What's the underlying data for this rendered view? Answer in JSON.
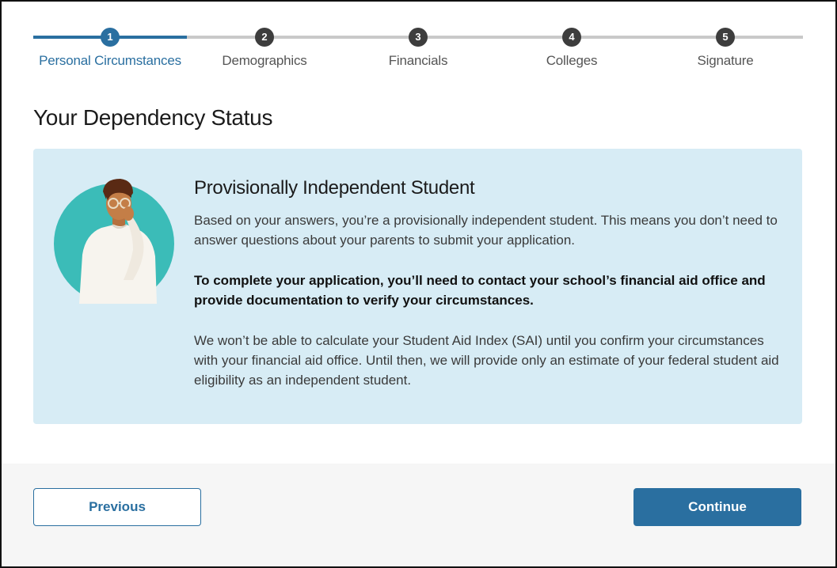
{
  "stepper": {
    "steps": [
      {
        "number": "1",
        "label": "Personal Circumstances"
      },
      {
        "number": "2",
        "label": "Demographics"
      },
      {
        "number": "3",
        "label": "Financials"
      },
      {
        "number": "4",
        "label": "Colleges"
      },
      {
        "number": "5",
        "label": "Signature"
      }
    ],
    "active_step": 1
  },
  "page": {
    "title": "Your Dependency Status"
  },
  "info": {
    "heading": "Provisionally Independent Student",
    "paragraph1": "Based on your answers, you’re a provisionally independent student. This means you don’t need to answer questions about your parents to submit your application.",
    "paragraph2": "To complete your application, you’ll need to contact your school’s financial aid office and provide documentation to verify your circumstances.",
    "paragraph3": "We won’t be able to calculate your Student Aid Index (SAI) until you confirm your circumstances with your financial aid office. Until then, we will provide only an estimate of your federal student aid eligibility as an independent student."
  },
  "footer": {
    "previous_label": "Previous",
    "continue_label": "Continue"
  },
  "colors": {
    "accent": "#2a6fa0",
    "info_background": "#d7ecf5",
    "illustration_circle": "#3bbcb8"
  }
}
